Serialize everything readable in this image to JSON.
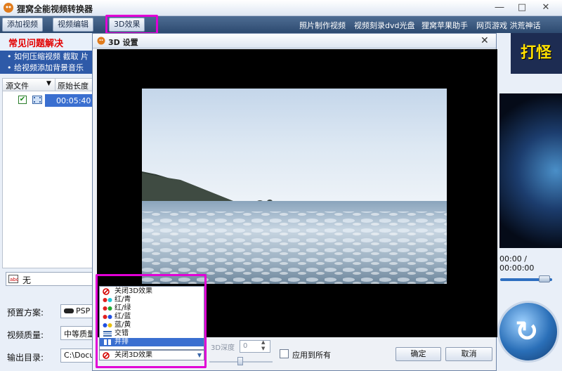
{
  "app": {
    "title": "狸窝全能视频转换器",
    "window_controls": {
      "minimize": "―",
      "maximize": "□",
      "close": "✕"
    }
  },
  "toolbar": {
    "add_video": "添加视频",
    "video_edit": "视频编辑",
    "effect_3d": "3D效果",
    "links": [
      "照片制作视频",
      "视频刻录dvd光盘",
      "狸窝苹果助手",
      "网页游戏 洪荒神话"
    ]
  },
  "faq": {
    "title": "常见问题解决",
    "items": [
      "• 如何压缩视频  截取  片",
      "• 给视频添加背景音乐"
    ]
  },
  "file_table": {
    "headers": [
      "源文件",
      "原始长度"
    ],
    "rows": [
      {
        "duration": "00:05:40"
      }
    ]
  },
  "subtitle_value": "无",
  "settings": {
    "preset_label": "预置方案:",
    "preset_value": "PSP",
    "quality_label": "视频质量:",
    "quality_value": "中等质量",
    "output_label": "输出目录:",
    "output_value": "C:\\Docu"
  },
  "ad": {
    "text": "打怪"
  },
  "right_preview": {
    "timecode": "00:00 / 00:00:00"
  },
  "dialog": {
    "title": "3D 设置",
    "close": "✕",
    "depth_label": "3D深度",
    "depth_value": "0",
    "apply_all_label": "应用到所有",
    "ok_button": "确定",
    "cancel_button": "取消",
    "dropdown_options": [
      "关闭3D效果",
      "红/青",
      "红/绿",
      "红/蓝",
      "蓝/黄",
      "交错",
      "并排"
    ],
    "dropdown_selected_index": 6,
    "dropdown_current": "关闭3D效果"
  },
  "colors": {
    "highlight": "#e100d6",
    "toolbar": "#2d4a70",
    "faq_title": "#e30000"
  }
}
